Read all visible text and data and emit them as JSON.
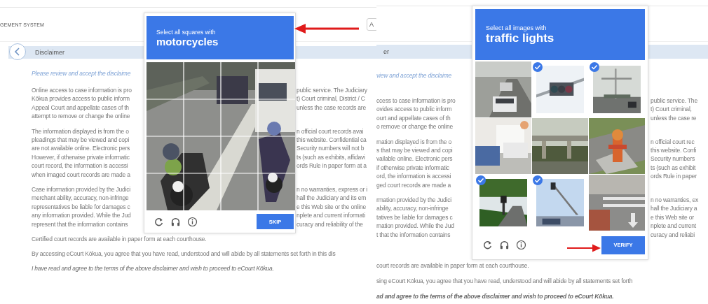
{
  "screens": [
    {
      "kind": "left",
      "app_title": "GEMENT SYSTEM",
      "field_text": "A",
      "section_title": "Disclaimer",
      "intro": "Please review and accept the disclaime",
      "paragraphs": [
        {
          "lines": [
            {
              "left": "Online access to case information is pro",
              "right": "public service. The Judiciary"
            },
            {
              "left": "Kōkua provides access to public inform",
              "right": "t) Court criminal, District / C"
            },
            {
              "left": "Appeal Court and appellate cases of th",
              "right": "unless the case records are"
            },
            {
              "left": "attempt to remove or change the online"
            }
          ]
        },
        {
          "lines": [
            {
              "left": "The information displayed is from the o",
              "right": "n official court records avai"
            },
            {
              "left": "pleadings that may be viewed and copi",
              "right": "this website. Confidential ca"
            },
            {
              "left": "are not available online. Electronic pers",
              "right": "Security numbers will not b"
            },
            {
              "left": "However, if otherwise private informatic",
              "right": "ts (such as exhibits, affidavi"
            },
            {
              "left": "court record, the information is accessi",
              "right": "ords Rule in paper form at a"
            },
            {
              "left": "when imaged court records are made a"
            }
          ]
        },
        {
          "lines": [
            {
              "left": "Case information provided by the Judici",
              "right": "n no warranties, express or i"
            },
            {
              "left": "merchant ability, accuracy, non-infringe",
              "right": "hall the Judiciary and its em"
            },
            {
              "left": "representatives be liable for damages c",
              "right": "e this Web site or the online"
            },
            {
              "left": "any information provided. While the Jud",
              "right": "nplete and current informati"
            },
            {
              "left": "represent that the information contains",
              "right": "curacy and reliability of the"
            }
          ]
        }
      ],
      "closing": [
        {
          "text": "Certified court records are available in paper form at each courthouse.",
          "italic": false
        },
        {
          "text": "By accessing eCourt Kōkua, you agree that you have read, understood and will abide by all statements set forth in this dis",
          "italic": false
        },
        {
          "text": "I have read and agree to the terms of the above disclaimer and wish to proceed to eCourt Kōkua.",
          "italic": true
        }
      ],
      "captcha": {
        "kind": "grid",
        "prompt": "Select all squares with",
        "target": "motorcycles",
        "button": "SKIP"
      }
    },
    {
      "kind": "right",
      "section_title": "er",
      "intro": "view and accept the disclaime",
      "paragraphs": [
        {
          "lines": [
            {
              "left": "ccess to case information is pro",
              "right": "public service. The"
            },
            {
              "left": "ovides access to public inform",
              "right": "t) Court criminal,"
            },
            {
              "left": "ourt and appellate cases of th",
              "right": "unless the case re"
            },
            {
              "left": "o remove or change the online"
            }
          ]
        },
        {
          "lines": [
            {
              "left": "mation displayed is from the o",
              "right": "n official court rec"
            },
            {
              "left": "s that may be viewed and copi",
              "right": "this website. Confi"
            },
            {
              "left": "vailable online. Electronic pers",
              "right": "Security numbers"
            },
            {
              "left": "if otherwise private informatic",
              "right": "ts (such as exhibit"
            },
            {
              "left": "ord, the information is accessi",
              "right": "ords Rule in paper"
            },
            {
              "left": "ged court records are made a"
            }
          ]
        },
        {
          "lines": [
            {
              "left": "rmation provided by the Judici",
              "right": "n no warranties, ex"
            },
            {
              "left": "ability, accuracy, non-infringe",
              "right": "hall the Judiciary a"
            },
            {
              "left": "tatives be liable for damages c",
              "right": "e this Web site or"
            },
            {
              "left": "mation provided. While the Jud",
              "right": "nplete and current"
            },
            {
              "left": "t that the information contains",
              "right": "curacy and reliabi"
            }
          ]
        }
      ],
      "closing": [
        {
          "text": "court records are available in paper form at each courthouse.",
          "italic": false
        },
        {
          "text": "sing eCourt Kōkua, you agree that you have read, understood and will abide by all statements set forth",
          "italic": false
        },
        {
          "text": "ad and agree to the terms of the above disclaimer and wish to proceed to eCourt Kōkua.",
          "italic": true
        }
      ],
      "captcha": {
        "kind": "tiles",
        "prompt": "Select all images with",
        "target": "traffic lights",
        "button": "VERIFY",
        "tiles": [
          {
            "selected": false
          },
          {
            "selected": true
          },
          {
            "selected": true
          },
          {
            "selected": false
          },
          {
            "selected": false
          },
          {
            "selected": false
          },
          {
            "selected": true
          },
          {
            "selected": true
          },
          {
            "selected": false
          }
        ]
      }
    }
  ]
}
